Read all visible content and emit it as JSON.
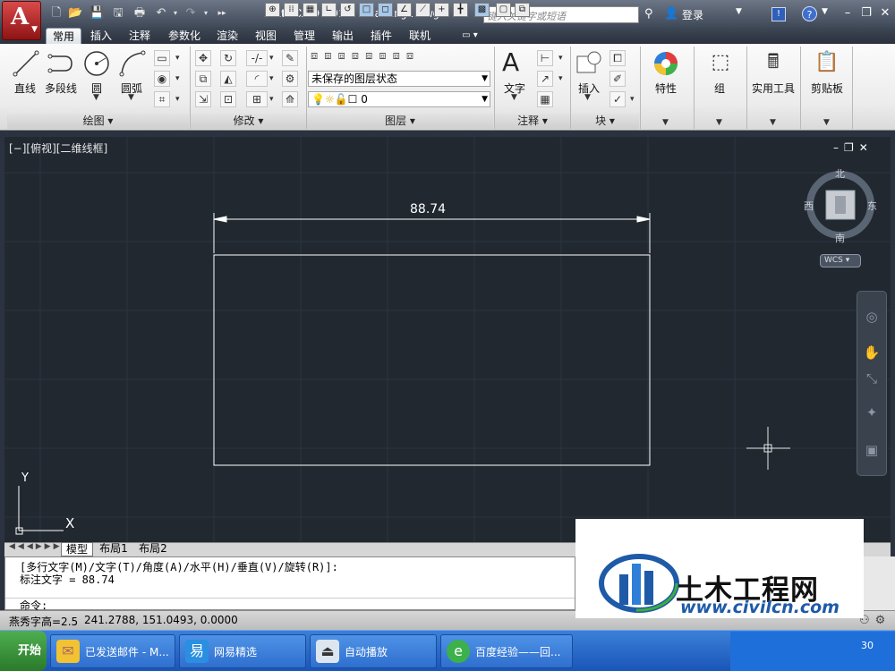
{
  "title": {
    "app": "AutoCAD 2012",
    "file": "Drawing1.dwg",
    "search_placeholder": "键入关键字或短语",
    "login": "登录"
  },
  "tabs": [
    "常用",
    "插入",
    "注释",
    "参数化",
    "渲染",
    "视图",
    "管理",
    "输出",
    "插件",
    "联机"
  ],
  "ribbon": {
    "draw": {
      "title": "绘图",
      "line": "直线",
      "polyline": "多段线",
      "circle": "圆",
      "arc": "圆弧"
    },
    "modify": {
      "title": "修改"
    },
    "layers": {
      "title": "图层",
      "state": "未保存的图层状态",
      "layer": "0"
    },
    "annotation": {
      "title": "注释",
      "text": "文字"
    },
    "block": {
      "title": "块",
      "insert": "插入"
    },
    "properties": "特性",
    "groups": "组",
    "utilities": "实用工具",
    "clipboard": "剪贴板"
  },
  "viewport": {
    "label": "[−][俯视][二维线框]",
    "compass": {
      "n": "北",
      "s": "南",
      "e": "东",
      "w": "西"
    },
    "ucs_btn": "WCS"
  },
  "drawing": {
    "dimension": "88.74",
    "ucs_x": "X",
    "ucs_y": "Y"
  },
  "layout_tabs": [
    "模型",
    "布局1",
    "布局2"
  ],
  "command": {
    "line1": "[多行文字(M)/文字(T)/角度(A)/水平(H)/垂直(V)/旋转(R)]:",
    "line2": "标注文字 = 88.74",
    "prompt": "命令:"
  },
  "status": {
    "text_height": "燕秀字高=2.5",
    "coords": "241.2788, 151.0493, 0.0000"
  },
  "taskbar": {
    "start": "开始",
    "items": [
      "已发送邮件 - M...",
      "网易精选",
      "自动播放",
      "百度经验——回..."
    ],
    "time": "30"
  },
  "watermark": {
    "brand": "土木工程网",
    "url": "www.civilcn.com"
  }
}
